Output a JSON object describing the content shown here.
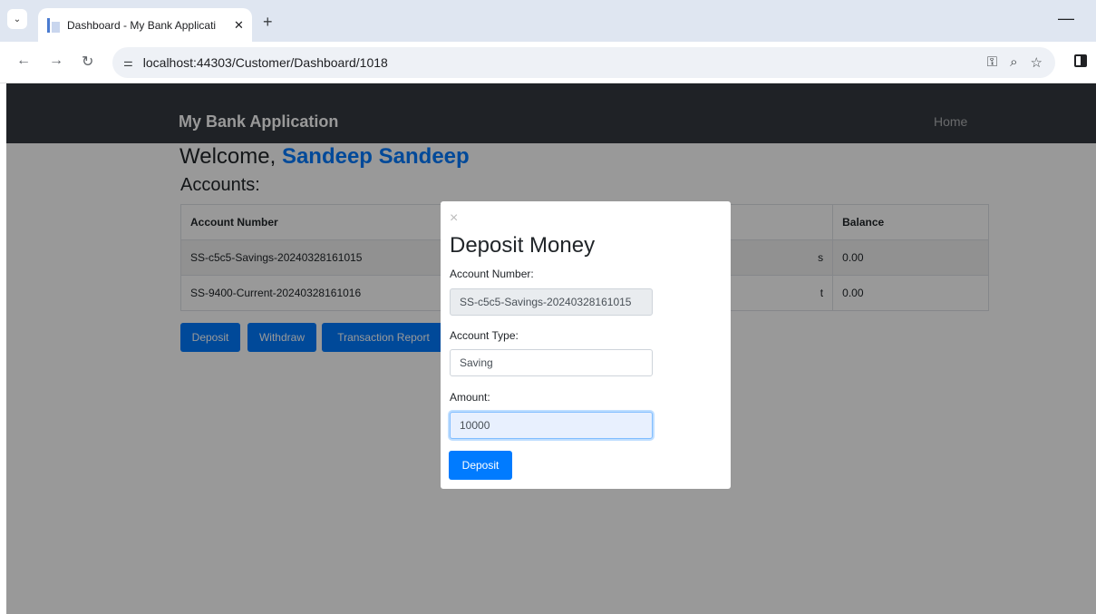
{
  "browser": {
    "tab_title": "Dashboard - My Bank Applicati",
    "tab_close": "✕",
    "new_tab": "+",
    "minimize": "—",
    "url": "localhost:44303/Customer/Dashboard/1018"
  },
  "navbar": {
    "brand": "My Bank Application",
    "home": "Home"
  },
  "main": {
    "welcome_prefix": "Welcome,",
    "customer_name": "Sandeep Sandeep",
    "accounts_heading": "Accounts:",
    "table": {
      "headers": [
        "Account Number",
        "",
        "Balance"
      ],
      "rows": [
        [
          "SS-c5c5-Savings-20240328161015",
          "s",
          "0.00"
        ],
        [
          "SS-9400-Current-20240328161016",
          "t",
          "0.00"
        ]
      ]
    },
    "buttons": {
      "deposit": "Deposit",
      "withdraw": "Withdraw",
      "transaction_report": "Transaction Report"
    }
  },
  "modal": {
    "close": "×",
    "title": "Deposit Money",
    "account_number_label": "Account Number:",
    "account_number_value": "SS-c5c5-Savings-20240328161015",
    "account_type_label": "Account Type:",
    "account_type_value": "Saving",
    "amount_label": "Amount:",
    "amount_value": "10000",
    "submit": "Deposit"
  },
  "colors": {
    "primary": "#007bff",
    "navbar": "#343a40"
  }
}
